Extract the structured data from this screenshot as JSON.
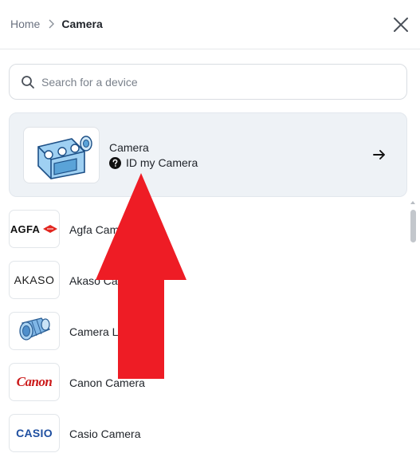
{
  "header": {
    "breadcrumb_home": "Home",
    "breadcrumb_current": "Camera",
    "close_icon": "close-icon"
  },
  "search": {
    "placeholder": "Search for a device",
    "value": ""
  },
  "featured": {
    "title": "Camera",
    "subtitle": "ID my Camera",
    "icon": "camera-illustration",
    "arrow_icon": "arrow-right-icon"
  },
  "list": {
    "items": [
      {
        "label": "Agfa Cam",
        "logo_text": "AGFA"
      },
      {
        "label": "Akaso Ca",
        "logo_text": "AKASO"
      },
      {
        "label": "Camera L",
        "logo_text": ""
      },
      {
        "label": "Canon Camera",
        "logo_text": "Canon"
      },
      {
        "label": "Casio Camera",
        "logo_text": "CASIO"
      }
    ]
  },
  "annotation": {
    "color": "#ee1c25",
    "direction": "up"
  },
  "colors": {
    "accent_featured_bg": "#eef2f6",
    "border": "#d9dde2",
    "text": "#1f2329",
    "muted": "#6b7280"
  }
}
